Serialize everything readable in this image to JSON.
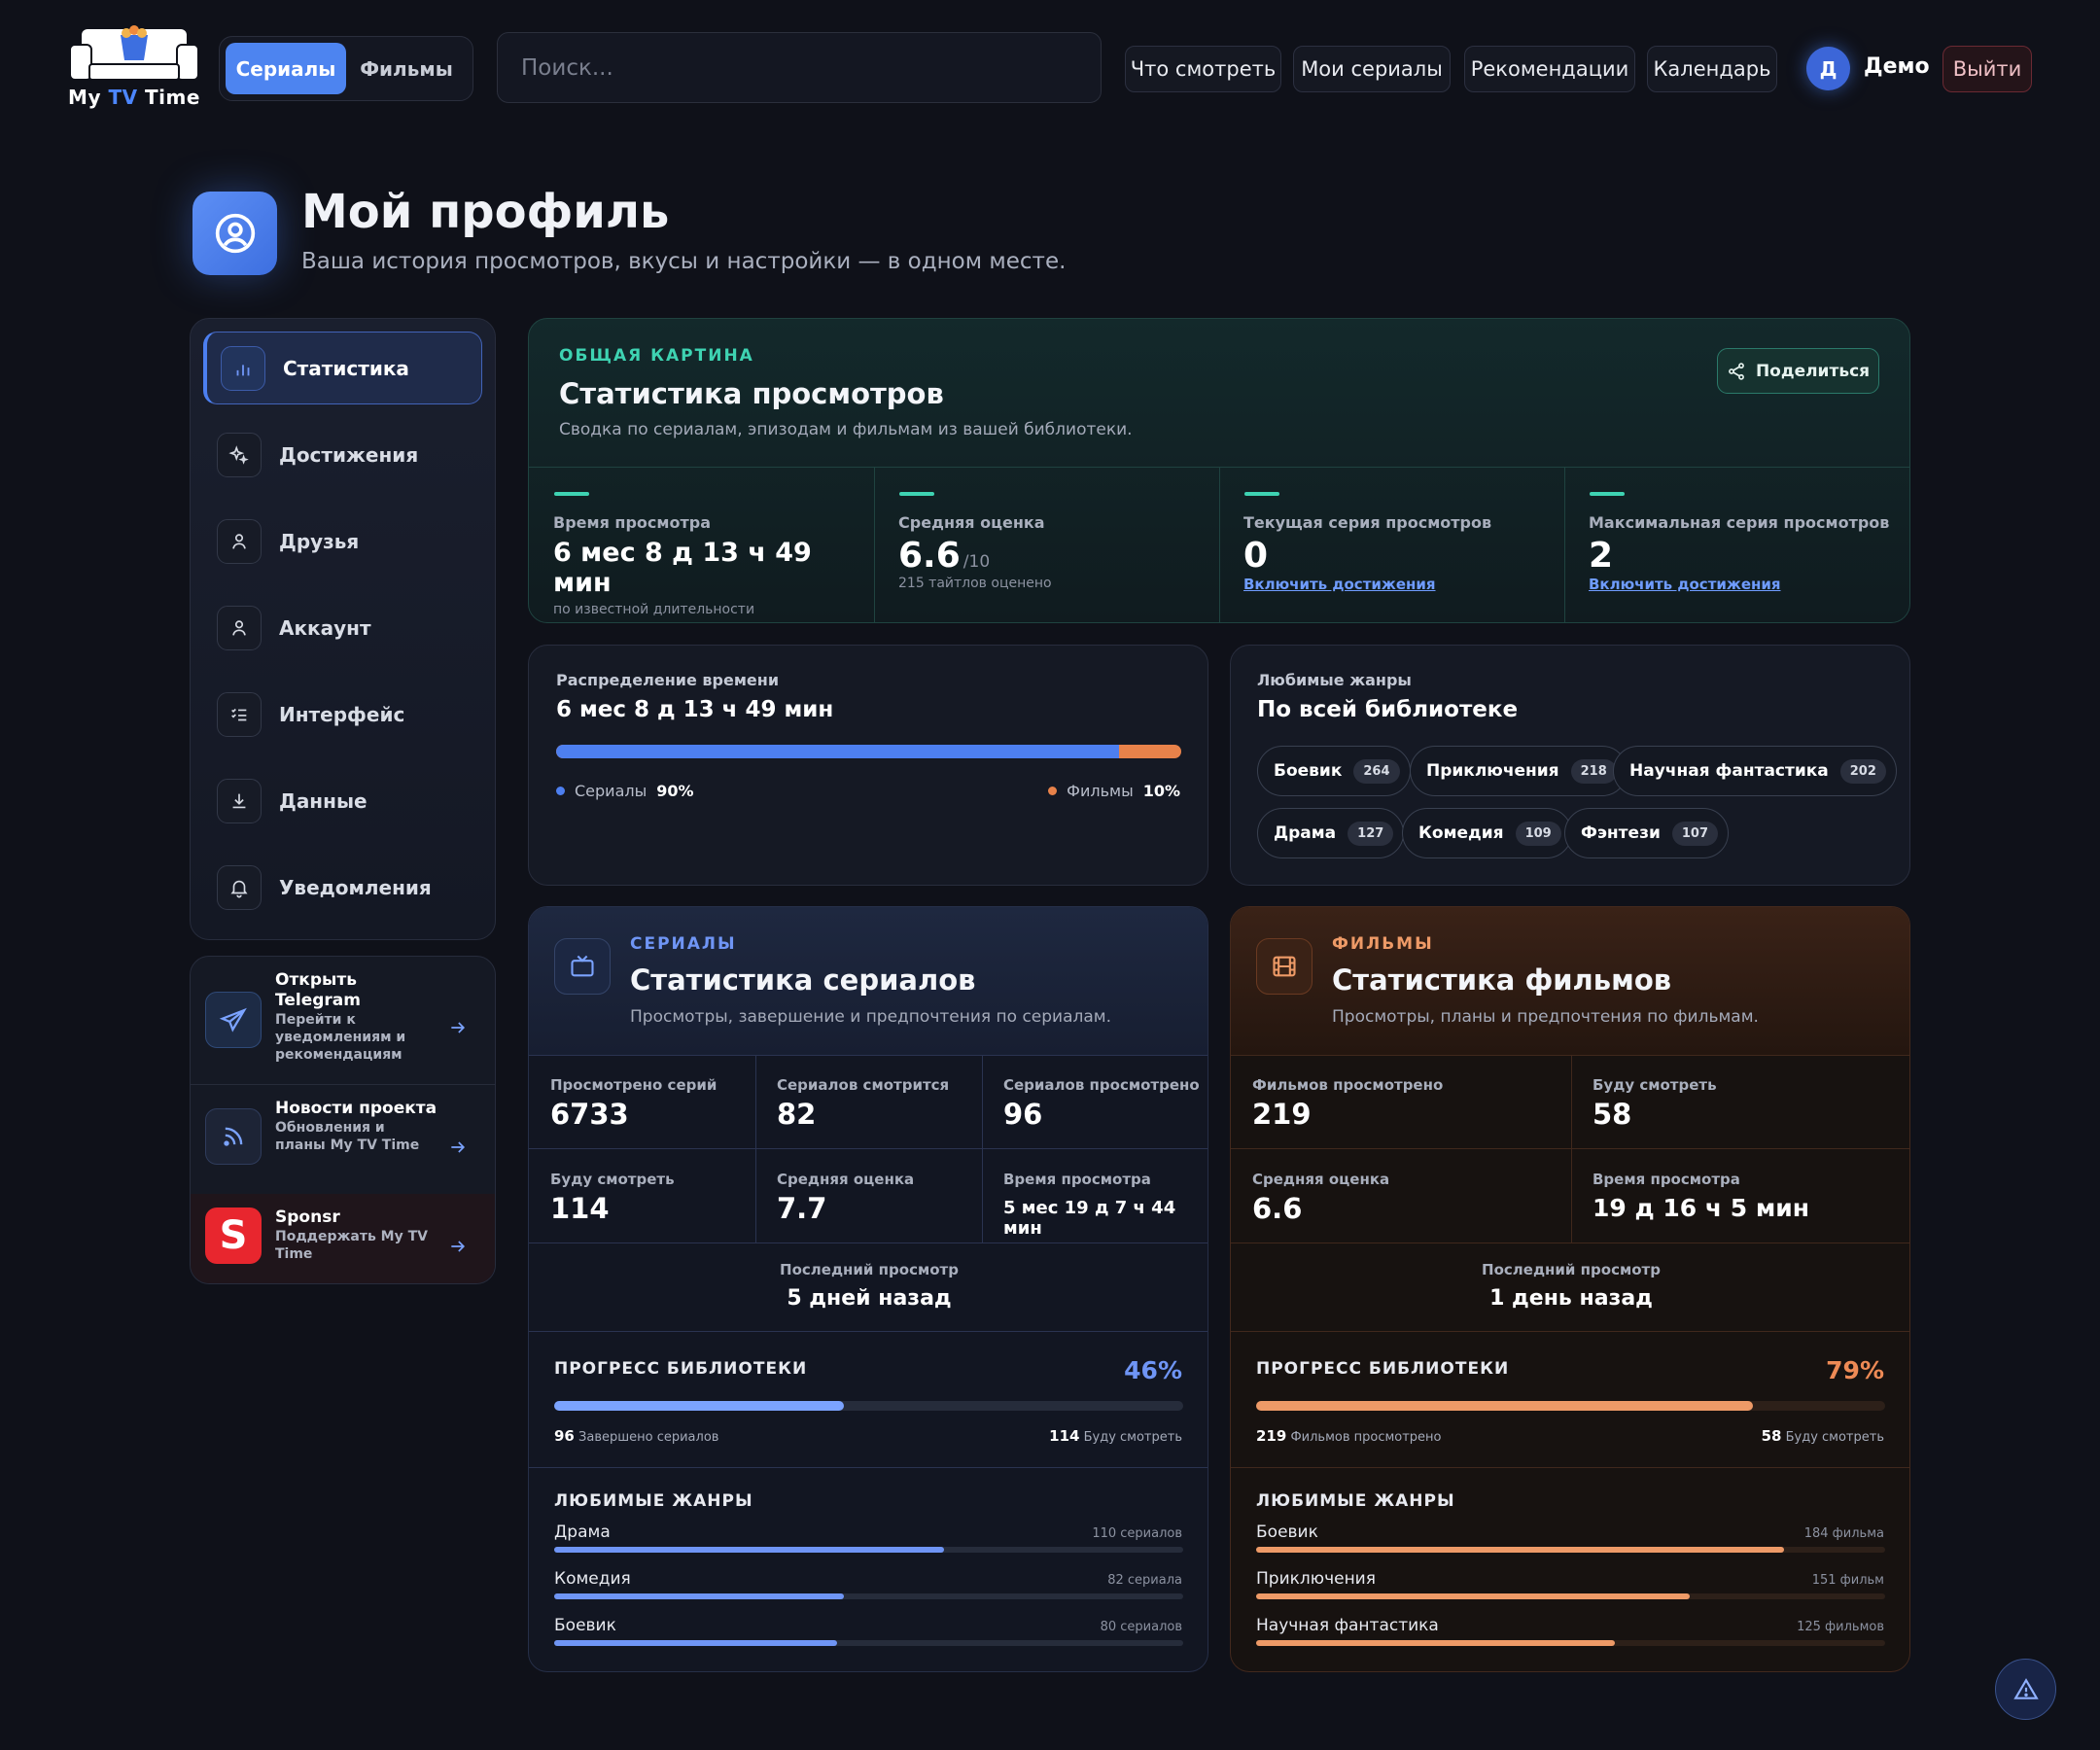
{
  "header": {
    "logo_text_a": "My ",
    "logo_text_b": "TV",
    "logo_text_c": " Time",
    "seg_series": "Сериалы",
    "seg_movies": "Фильмы",
    "search_placeholder": "Поиск...",
    "nav": [
      "Что смотреть",
      "Мои сериалы",
      "Рекомендации",
      "Календарь"
    ],
    "avatar_letter": "Д",
    "user_name": "Демо",
    "logout": "Выйти"
  },
  "page": {
    "title": "Мой профиль",
    "subtitle": "Ваша история просмотров, вкусы и настройки — в одном месте."
  },
  "sidebar": {
    "items": [
      {
        "label": "Статистика",
        "icon": "bar-chart-icon"
      },
      {
        "label": "Достижения",
        "icon": "sparkles-icon"
      },
      {
        "label": "Друзья",
        "icon": "user-icon"
      },
      {
        "label": "Аккаунт",
        "icon": "user-icon"
      },
      {
        "label": "Интерфейс",
        "icon": "list-check-icon"
      },
      {
        "label": "Данные",
        "icon": "download-icon"
      },
      {
        "label": "Уведомления",
        "icon": "bell-icon"
      }
    ],
    "links": [
      {
        "title": "Открыть Telegram",
        "desc": "Перейти к уведомлениям и рекомендациям",
        "icon": "telegram-icon"
      },
      {
        "title": "Новости проекта",
        "desc": "Обновления и планы My TV Time",
        "icon": "rss-icon"
      },
      {
        "title": "Sponsr",
        "desc": "Поддержать My TV Time",
        "icon": "sponsr-logo-icon"
      }
    ]
  },
  "overview": {
    "kicker": "ОБЩАЯ КАРТИНА",
    "title": "Статистика просмотров",
    "subtitle": "Сводка по сериалам, эпизодам и фильмам из вашей библиотеки.",
    "share": "Поделиться",
    "stats": [
      {
        "label": "Время просмотра",
        "value": "6 мес 8 д 13 ч 49 мин",
        "note": "по известной длительности"
      },
      {
        "label": "Средняя оценка",
        "value": "6.6",
        "suffix": "/10",
        "note": "215 тайтлов оценено"
      },
      {
        "label": "Текущая серия просмотров",
        "value": "0",
        "link": "Включить достижения"
      },
      {
        "label": "Максимальная серия просмотров",
        "value": "2",
        "link": "Включить достижения"
      }
    ]
  },
  "distribution": {
    "label": "Распределение времени",
    "value": "6 мес 8 д 13 ч 49 мин",
    "series_label": "Сериалы",
    "series_pct": "90%",
    "series_frac": 0.9,
    "movies_label": "Фильмы",
    "movies_pct": "10%",
    "colors": {
      "series": "#4d7ff0",
      "movies": "#e8824a"
    }
  },
  "genres_all": {
    "label": "Любимые жанры",
    "title": "По всей библиотеке",
    "chips": [
      {
        "name": "Боевик",
        "count": "264"
      },
      {
        "name": "Приключения",
        "count": "218"
      },
      {
        "name": "Научная фантастика",
        "count": "202"
      },
      {
        "name": "Драма",
        "count": "127"
      },
      {
        "name": "Комедия",
        "count": "109"
      },
      {
        "name": "Фэнтези",
        "count": "107"
      }
    ]
  },
  "series": {
    "kicker": "СЕРИАЛЫ",
    "title": "Статистика сериалов",
    "subtitle": "Просмотры, завершение и предпочтения по сериалам.",
    "stats": [
      {
        "label": "Просмотрено серий",
        "value": "6733"
      },
      {
        "label": "Сериалов смотрится",
        "value": "82"
      },
      {
        "label": "Сериалов просмотрено",
        "value": "96"
      },
      {
        "label": "Буду смотреть",
        "value": "114"
      },
      {
        "label": "Средняя оценка",
        "value": "7.7"
      },
      {
        "label": "Время просмотра",
        "value": "5 мес 19 д 7 ч 44 мин"
      }
    ],
    "last_label": "Последний просмотр",
    "last_value": "5 дней назад",
    "progress_label": "ПРОГРЕСС БИБЛИОТЕКИ",
    "progress_pct": "46%",
    "progress_frac": 0.46,
    "progress_left_num": "96",
    "progress_left_txt": "Завершено сериалов",
    "progress_right_num": "114",
    "progress_right_txt": "Буду смотреть",
    "genres_label": "ЛЮБИМЫЕ ЖАНРЫ",
    "genres": [
      {
        "name": "Драма",
        "count": "110 сериалов",
        "frac": 0.62
      },
      {
        "name": "Комедия",
        "count": "82 сериала",
        "frac": 0.46
      },
      {
        "name": "Боевик",
        "count": "80 сериалов",
        "frac": 0.45
      }
    ],
    "color": "#6f95f5"
  },
  "movies": {
    "kicker": "ФИЛЬМЫ",
    "title": "Статистика фильмов",
    "subtitle": "Просмотры, планы и предпочтения по фильмам.",
    "stats": [
      {
        "label": "Фильмов просмотрено",
        "value": "219"
      },
      {
        "label": "Буду смотреть",
        "value": "58"
      },
      {
        "label": "Средняя оценка",
        "value": "6.6"
      },
      {
        "label": "Время просмотра",
        "value": "19 д 16 ч 5 мин"
      }
    ],
    "last_label": "Последний просмотр",
    "last_value": "1 день назад",
    "progress_label": "ПРОГРЕСС БИБЛИОТЕКИ",
    "progress_pct": "79%",
    "progress_frac": 0.79,
    "progress_left_num": "219",
    "progress_left_txt": "Фильмов просмотрено",
    "progress_right_num": "58",
    "progress_right_txt": "Буду смотреть",
    "genres_label": "ЛЮБИМЫЕ ЖАНРЫ",
    "genres": [
      {
        "name": "Боевик",
        "count": "184 фильма",
        "frac": 0.84
      },
      {
        "name": "Приключения",
        "count": "151 фильм",
        "frac": 0.69
      },
      {
        "name": "Научная фантастика",
        "count": "125 фильмов",
        "frac": 0.57
      }
    ],
    "color": "#ee9a67"
  }
}
